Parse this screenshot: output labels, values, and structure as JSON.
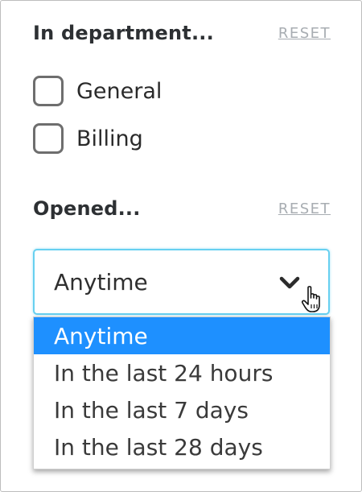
{
  "department": {
    "title": "In department...",
    "reset_label": "RESET",
    "options": [
      {
        "label": "General",
        "checked": false
      },
      {
        "label": "Billing",
        "checked": false
      }
    ]
  },
  "opened": {
    "title": "Opened...",
    "reset_label": "RESET",
    "select": {
      "value": "Anytime",
      "options": [
        "Anytime",
        "In the last 24 hours",
        "In the last 7 days",
        "In the last 28 days"
      ],
      "highlighted_index": 0
    }
  },
  "colors": {
    "highlight": "#1e90ff",
    "focus_border": "#67d0f0",
    "reset_text": "#a8adb2"
  },
  "icons": [
    "chevron-down-icon",
    "hand-pointer-cursor-icon"
  ]
}
